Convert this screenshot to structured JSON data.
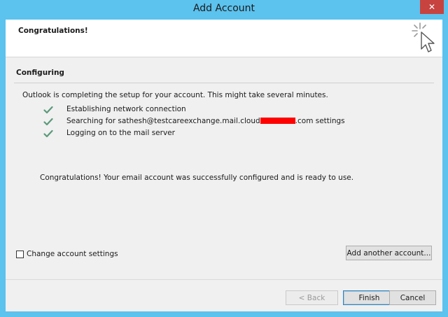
{
  "window": {
    "title": "Add Account",
    "close_glyph": "✕"
  },
  "header": {
    "title": "Congratulations!",
    "icon": "cursor-sparkle-icon"
  },
  "section": {
    "title": "Configuring"
  },
  "intro": "Outlook is completing the setup for your account. This might take several minutes.",
  "steps": [
    {
      "label": "Establishing network connection",
      "status": "done"
    },
    {
      "label_before": "Searching for sathesh@testcareexchange.mail.cloud",
      "label_after": ".com settings",
      "redacted": true,
      "status": "done"
    },
    {
      "label": "Logging on to the mail server",
      "status": "done"
    }
  ],
  "message": "Congratulations! Your email account was successfully configured and is ready to use.",
  "change_settings": {
    "label": "Change account settings",
    "checked": false
  },
  "buttons": {
    "add_another": "Add another account...",
    "back": "< Back",
    "finish": "Finish",
    "cancel": "Cancel"
  },
  "colors": {
    "titlebar": "#5cc2ee",
    "check": "#5a9a7a",
    "redaction": "#ff0000",
    "close": "#c7433f"
  }
}
